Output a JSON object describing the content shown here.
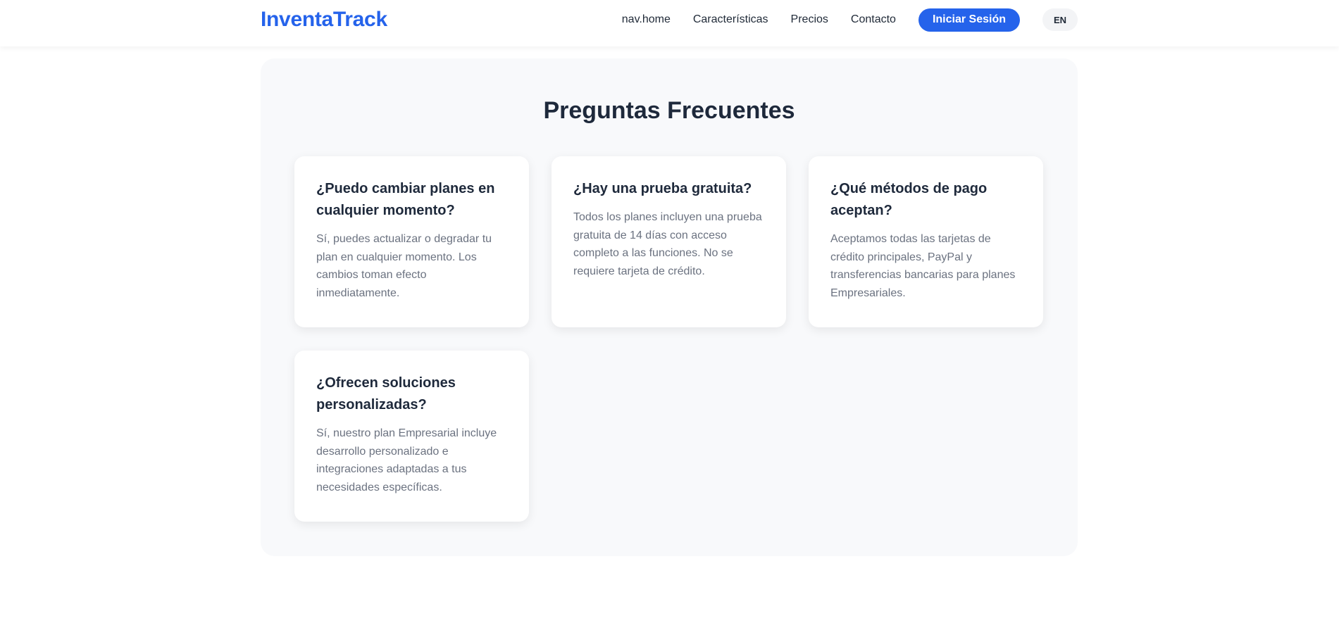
{
  "header": {
    "logo": "InventaTrack",
    "nav": [
      "nav.home",
      "Características",
      "Precios",
      "Contacto"
    ],
    "login_label": "Iniciar Sesión",
    "lang_label": "EN"
  },
  "faq": {
    "title": "Preguntas Frecuentes",
    "items": [
      {
        "question": "¿Puedo cambiar planes en cualquier momento?",
        "answer": "Sí, puedes actualizar o degradar tu plan en cualquier momento. Los cambios toman efecto inmediatamente."
      },
      {
        "question": "¿Hay una prueba gratuita?",
        "answer": "Todos los planes incluyen una prueba gratuita de 14 días con acceso completo a las funciones. No se requiere tarjeta de crédito."
      },
      {
        "question": "¿Qué métodos de pago aceptan?",
        "answer": "Aceptamos todas las tarjetas de crédito principales, PayPal y transferencias bancarias para planes Empresariales."
      },
      {
        "question": "¿Ofrecen soluciones personalizadas?",
        "answer": "Sí, nuestro plan Empresarial incluye desarrollo personalizado e integraciones adaptadas a tus necesidades específicas."
      }
    ]
  },
  "colors": {
    "accent": "#2563eb",
    "section_bg": "#f8f9fb",
    "heading": "#1e293b",
    "muted_text": "#6b7280"
  }
}
